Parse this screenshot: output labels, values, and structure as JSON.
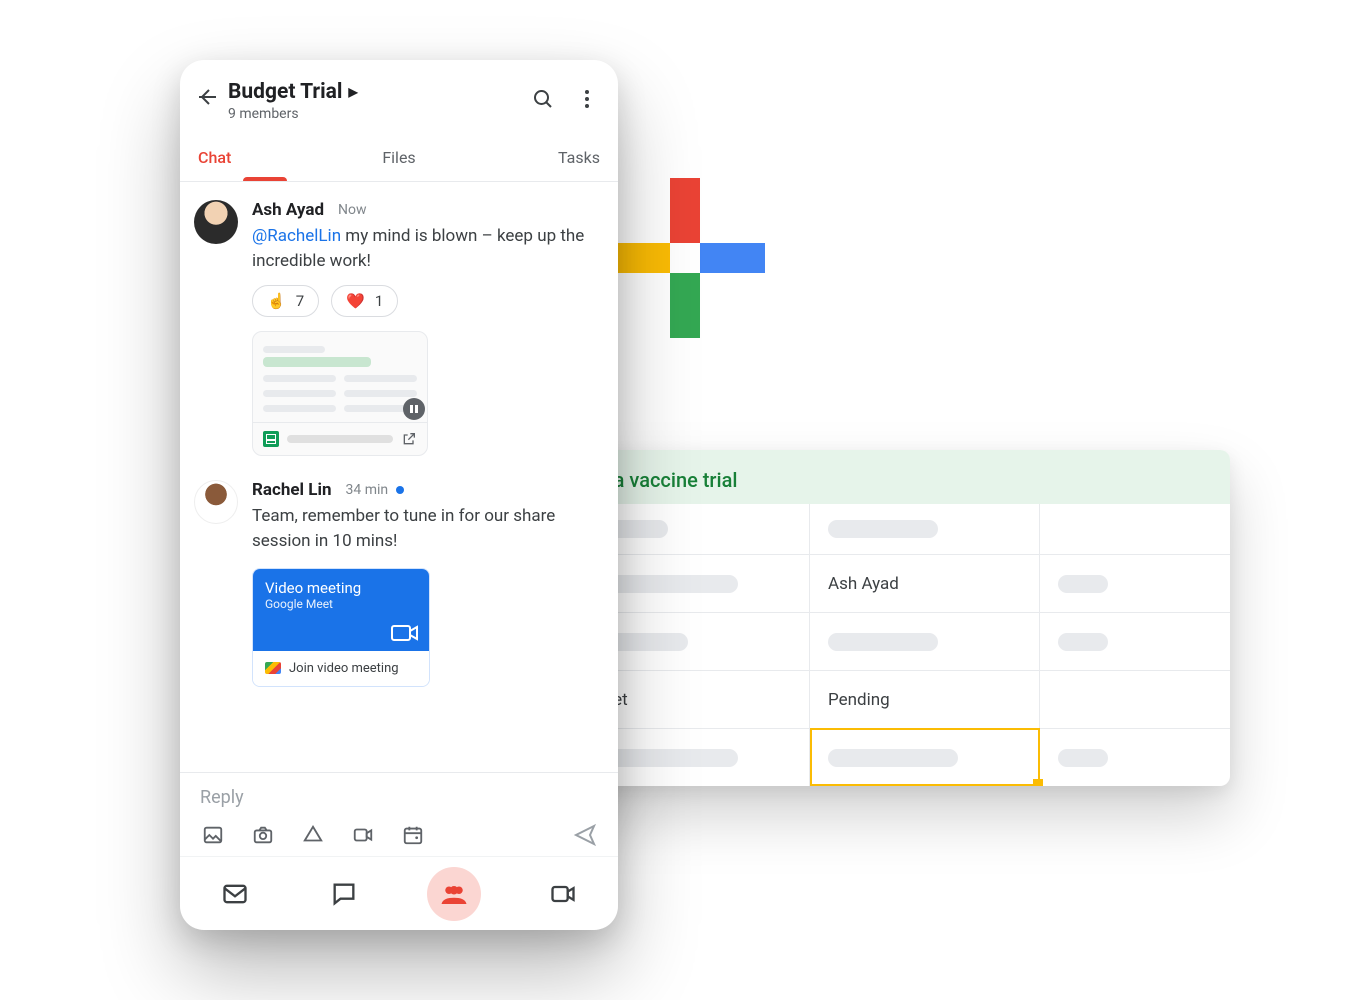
{
  "colors": {
    "accent_red": "#ea4335",
    "link_blue": "#1a73e8",
    "green": "#188038",
    "selection_yellow": "#fbbc04"
  },
  "logo": {
    "type": "google-plus-shape",
    "colors": [
      "#ea4335",
      "#4285f4",
      "#34a853",
      "#fbbc05"
    ]
  },
  "sheet": {
    "title": "Influenza vaccine trial",
    "rows": [
      {
        "c1": "",
        "c2": "",
        "c3": ""
      },
      {
        "c1": "",
        "c2": "Ash Ayad",
        "c3": ""
      },
      {
        "c1": "",
        "c2": "",
        "c3": ""
      },
      {
        "c1": "Trial budget",
        "c2": "Pending",
        "c3": ""
      },
      {
        "c1": "",
        "c2": "",
        "c3": ""
      }
    ],
    "selected": {
      "row_index": 3,
      "col": "c2"
    }
  },
  "chat": {
    "header": {
      "title": "Budget Trial",
      "subtitle": "9 members"
    },
    "tabs": [
      {
        "label": "Chat",
        "active": true
      },
      {
        "label": "Files",
        "active": false
      },
      {
        "label": "Tasks",
        "active": false
      }
    ],
    "messages": [
      {
        "author": "Ash Ayad",
        "time": "Now",
        "presence": false,
        "mention": "@RachelLin",
        "text_after_mention": " my mind is blown – keep up the incredible work!",
        "reactions": [
          {
            "emoji": "☝️",
            "count": 7
          },
          {
            "emoji": "❤️",
            "count": 1
          }
        ],
        "attachment": {
          "type": "google-sheets"
        }
      },
      {
        "author": "Rachel Lin",
        "time": "34 min",
        "presence": true,
        "text": "Team, remember to tune in for our share session in 10 mins!",
        "meet_card": {
          "title": "Video meeting",
          "subtitle": "Google Meet",
          "join_label": "Join video meeting"
        }
      }
    ],
    "composer": {
      "placeholder": "Reply"
    },
    "composer_icons": [
      "image-icon",
      "camera-icon",
      "drive-icon",
      "video-icon",
      "calendar-icon",
      "send-icon"
    ],
    "bottom_nav": [
      "mail-icon",
      "chat-bubble-icon",
      "people-icon",
      "video-icon"
    ],
    "bottom_nav_active_index": 2
  }
}
